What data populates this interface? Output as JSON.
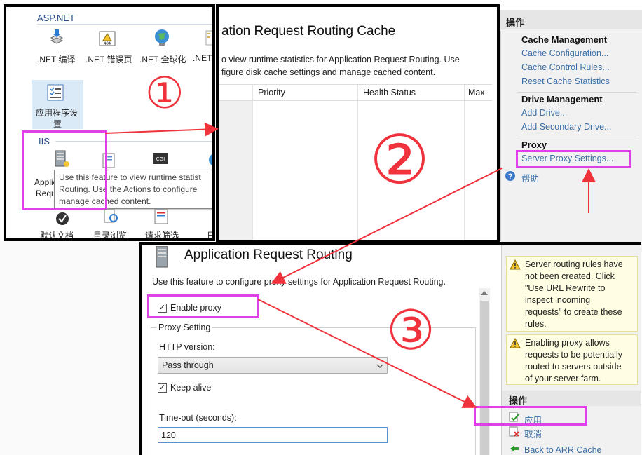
{
  "left_panel": {
    "aspnet_group": "ASP.NET",
    "iis_group": "IIS",
    "tiles_row1": [
      ".NET 编译",
      ".NET 错误页",
      ".NET 全球化",
      ".NET"
    ],
    "app_settings_label_l1": "应用程序设",
    "app_settings_label_l2": "置",
    "arr_label_l1": "Applica",
    "arr_label_l2": "Reque",
    "tooltip_l1": "Use this feature to view runtime statist",
    "tooltip_l2": "Routing.  Use the Actions to configure",
    "tooltip_l3": "manage cached content.",
    "tiles_row3": [
      "默认文档",
      "目录浏览",
      "请求筛选",
      "日"
    ],
    "step_number": "①"
  },
  "cache_panel": {
    "title": "ation Request Routing Cache",
    "desc_l1": "o view runtime statistics for Application Request Routing.  Use",
    "desc_l2": "figure disk cache settings and manage cached content.",
    "columns": [
      "Priority",
      "Health Status",
      "Max"
    ],
    "step_number": "②"
  },
  "actions_panel_top": {
    "header": "操作",
    "groups": [
      {
        "title": "Cache Management",
        "links": [
          "Cache Configuration...",
          "Cache Control Rules...",
          "Reset Cache Statistics"
        ]
      },
      {
        "title": "Drive Management",
        "links": [
          "Add Drive...",
          "Add Secondary Drive..."
        ]
      },
      {
        "title": "Proxy",
        "links": [
          "Server Proxy Settings..."
        ]
      }
    ],
    "help": "帮助"
  },
  "proxy_panel": {
    "title": "Application Request Routing",
    "desc": "Use this feature to configure proxy settings for Application Request Routing.",
    "enable_proxy": "Enable proxy",
    "proxy_setting_group": "Proxy Setting",
    "http_version_label": "HTTP version:",
    "http_version_value": "Pass through",
    "keep_alive": "Keep alive",
    "timeout_label": "Time-out (seconds):",
    "timeout_value": "120",
    "step_number": "③"
  },
  "actions_panel_bottom": {
    "warning1": [
      "Server routing rules have",
      "not been created. Click",
      "\"Use URL Rewrite to",
      "inspect incoming",
      "requests\" to create these",
      "rules."
    ],
    "warning2": [
      "Enabling proxy allows",
      "requests to be potentially",
      "routed to servers outside",
      "of your server farm."
    ],
    "header": "操作",
    "apply": "应用",
    "cancel": "取消",
    "back": "Back to ARR Cache"
  },
  "colors": {
    "highlight": "#e040e8",
    "arrow": "#f0323c",
    "link": "#3a6ea5"
  }
}
